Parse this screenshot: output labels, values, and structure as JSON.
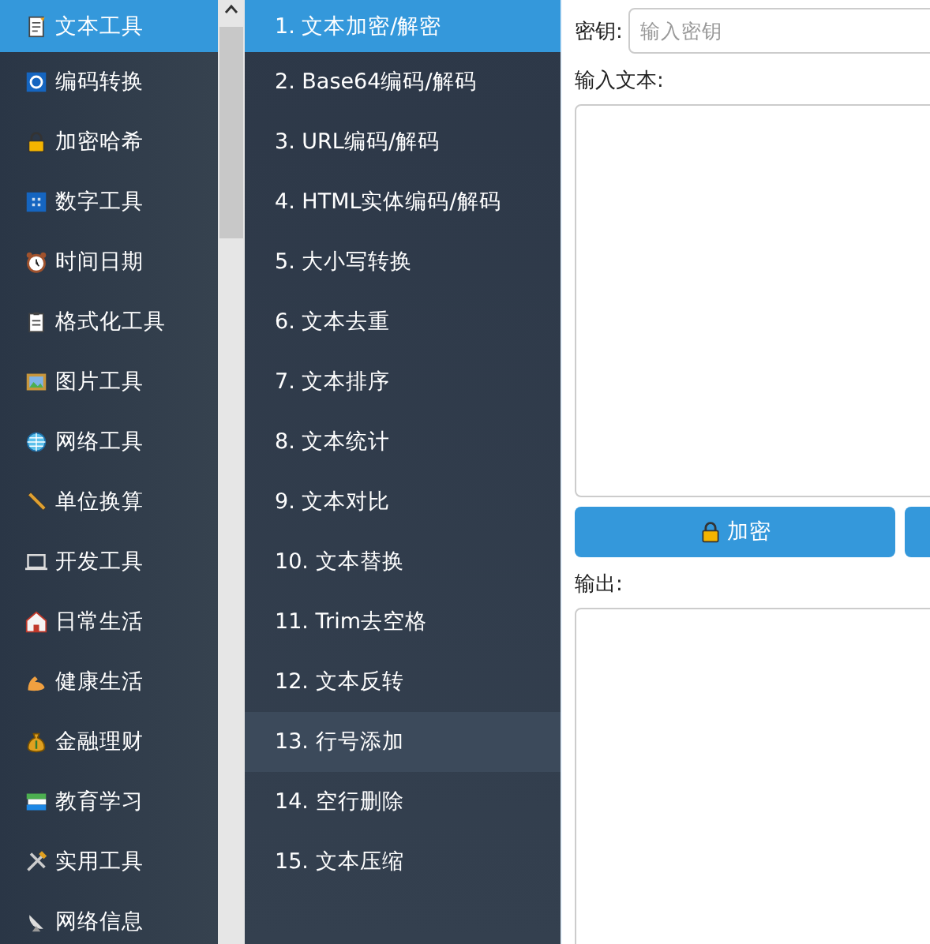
{
  "categories": [
    {
      "label": "文本工具",
      "selected": true
    },
    {
      "label": "编码转换",
      "selected": false
    },
    {
      "label": "加密哈希",
      "selected": false
    },
    {
      "label": "数字工具",
      "selected": false
    },
    {
      "label": "时间日期",
      "selected": false
    },
    {
      "label": "格式化工具",
      "selected": false
    },
    {
      "label": "图片工具",
      "selected": false
    },
    {
      "label": "网络工具",
      "selected": false
    },
    {
      "label": "单位换算",
      "selected": false
    },
    {
      "label": "开发工具",
      "selected": false
    },
    {
      "label": "日常生活",
      "selected": false
    },
    {
      "label": "健康生活",
      "selected": false
    },
    {
      "label": "金融理财",
      "selected": false
    },
    {
      "label": "教育学习",
      "selected": false
    },
    {
      "label": "实用工具",
      "selected": false
    },
    {
      "label": "网络信息",
      "selected": false
    }
  ],
  "tools": [
    {
      "label": "1. 文本加密/解密",
      "selected": true,
      "hovered": false
    },
    {
      "label": "2. Base64编码/解码",
      "selected": false,
      "hovered": false
    },
    {
      "label": "3. URL编码/解码",
      "selected": false,
      "hovered": false
    },
    {
      "label": "4. HTML实体编码/解码",
      "selected": false,
      "hovered": false
    },
    {
      "label": "5. 大小写转换",
      "selected": false,
      "hovered": false
    },
    {
      "label": "6. 文本去重",
      "selected": false,
      "hovered": false
    },
    {
      "label": "7. 文本排序",
      "selected": false,
      "hovered": false
    },
    {
      "label": "8. 文本统计",
      "selected": false,
      "hovered": false
    },
    {
      "label": "9. 文本对比",
      "selected": false,
      "hovered": false
    },
    {
      "label": "10. 文本替换",
      "selected": false,
      "hovered": false
    },
    {
      "label": "11. Trim去空格",
      "selected": false,
      "hovered": false
    },
    {
      "label": "12. 文本反转",
      "selected": false,
      "hovered": false
    },
    {
      "label": "13. 行号添加",
      "selected": false,
      "hovered": true
    },
    {
      "label": "14. 空行删除",
      "selected": false,
      "hovered": false
    },
    {
      "label": "15. 文本压缩",
      "selected": false,
      "hovered": false
    }
  ],
  "panel": {
    "key_label": "密钥:",
    "key_placeholder": "输入密钥",
    "input_label": "输入文本:",
    "output_label": "输出:",
    "buttons": [
      {
        "kind": "encrypt",
        "label": "加密"
      },
      {
        "kind": "partial"
      }
    ]
  }
}
